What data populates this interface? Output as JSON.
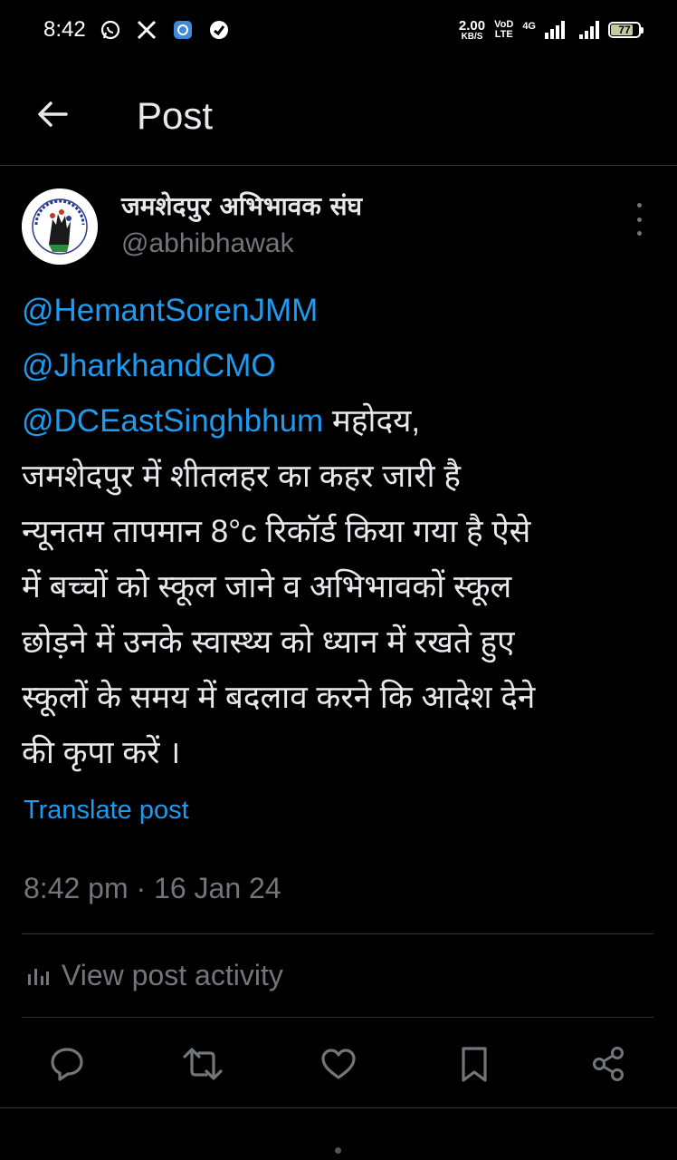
{
  "status_bar": {
    "time": "8:42",
    "net_speed_value": "2.00",
    "net_speed_unit": "KB/S",
    "volte_top": "VoD",
    "volte_bottom": "LTE",
    "network_type": "4G",
    "battery_level": "77",
    "notification_icons": [
      "whatsapp-icon",
      "x-icon",
      "app-icon",
      "browser-icon"
    ]
  },
  "header": {
    "title": "Post"
  },
  "author": {
    "display_name": "जमशेदपुर अभिभावक संघ",
    "handle": "@abhibhawak"
  },
  "post": {
    "mentions": [
      "@HemantSorenJMM",
      "@JharkhandCMO",
      "@DCEastSinghbhum"
    ],
    "text_after_mentions": " महोदय,",
    "body_lines": [
      "जमशेदपुर में शीतलहर का कहर जारी है",
      "न्यूनतम तापमान 8°c रिकॉर्ड किया गया है ऐसे",
      "में बच्चों को स्कूल जाने व अभिभावकों स्कूल",
      "छोड़ने में उनके स्वास्थ्य को ध्यान में रखते हुए",
      "स्कूलों के समय में बदलाव करने कि आदेश देने",
      "की कृपा करें ।"
    ],
    "translate_label": "Translate post",
    "timestamp": "8:42 pm · 16 Jan 24"
  },
  "activity": {
    "label": "View post activity"
  },
  "actions": [
    "reply-icon",
    "repost-icon",
    "like-icon",
    "bookmark-icon",
    "share-icon"
  ],
  "colors": {
    "background": "#000000",
    "text": "#e7e9ea",
    "secondary": "#71767b",
    "accent": "#1d9bf0",
    "divider": "#2f3336"
  }
}
